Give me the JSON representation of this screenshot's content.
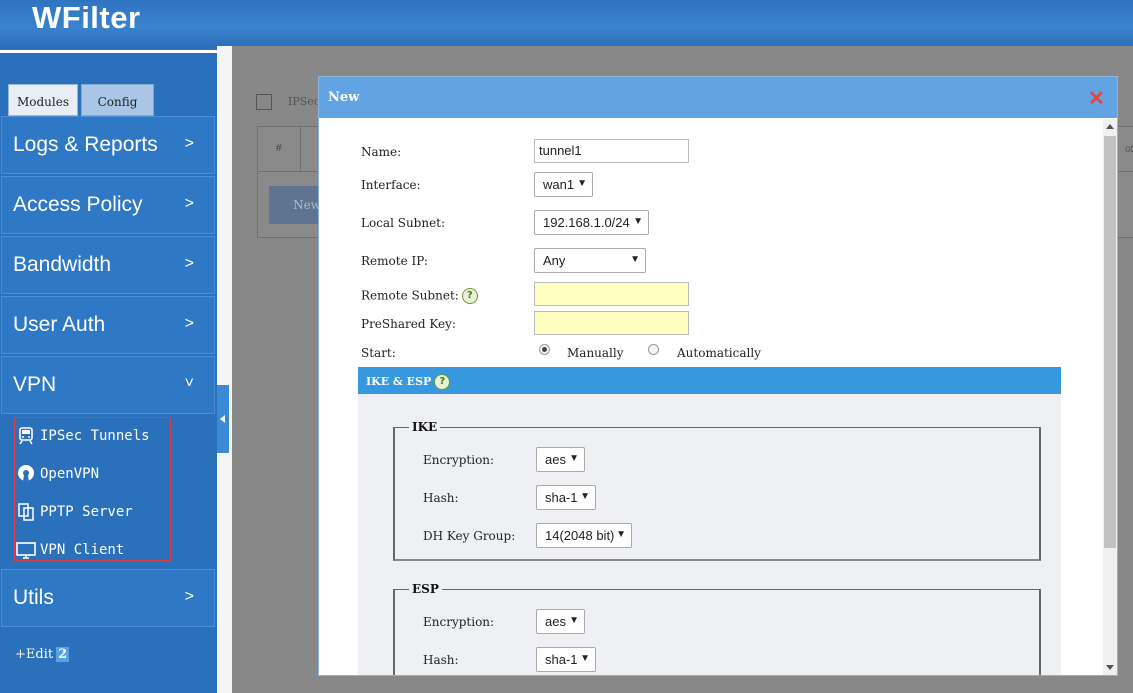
{
  "app": {
    "logo": "WFilter"
  },
  "sidebar": {
    "tabs": [
      {
        "label": "Modules"
      },
      {
        "label": "Config"
      }
    ],
    "menu": [
      {
        "label": "Logs & Reports",
        "arrow": ">"
      },
      {
        "label": "Access Policy",
        "arrow": ">"
      },
      {
        "label": "Bandwidth",
        "arrow": ">"
      },
      {
        "label": "User Auth",
        "arrow": ">"
      },
      {
        "label": "VPN",
        "arrow": "˅"
      },
      {
        "label": "Utils",
        "arrow": ">"
      }
    ],
    "vpn_items": [
      {
        "label": "IPSec Tunnels",
        "icon": "train-icon"
      },
      {
        "label": "OpenVPN",
        "icon": "openvpn-icon"
      },
      {
        "label": "PPTP Server",
        "icon": "pptp-icon"
      },
      {
        "label": "VPN Client",
        "icon": "monitor-icon"
      }
    ],
    "edit": {
      "label": "+Edit",
      "count": "2"
    }
  },
  "background_page": {
    "title": "IPSec V",
    "hash": "#",
    "new_button": "New",
    "right_fragment": "ot"
  },
  "dialog": {
    "title": "New",
    "close": "✕",
    "fields": {
      "name": {
        "label": "Name:",
        "value": "tunnel1"
      },
      "interface": {
        "label": "Interface:",
        "value": "wan1"
      },
      "local_subnet": {
        "label": "Local Subnet:",
        "value": "192.168.1.0/24"
      },
      "remote_ip": {
        "label": "Remote IP:",
        "value": "Any"
      },
      "remote_subnet": {
        "label": "Remote Subnet:",
        "value": ""
      },
      "preshared_key": {
        "label": "PreShared Key:",
        "value": ""
      },
      "start": {
        "label": "Start:",
        "options": [
          "Manually",
          "Automatically"
        ],
        "selected": "Manually"
      }
    },
    "section": {
      "title": "IKE & ESP"
    },
    "ike": {
      "legend": "IKE",
      "encryption": {
        "label": "Encryption:",
        "value": "aes"
      },
      "hash": {
        "label": "Hash:",
        "value": "sha-1"
      },
      "dh_group": {
        "label": "DH Key Group:",
        "value": "14(2048 bit)"
      }
    },
    "esp": {
      "legend": "ESP",
      "encryption": {
        "label": "Encryption:",
        "value": "aes"
      },
      "hash": {
        "label": "Hash:",
        "value": "sha-1"
      }
    }
  },
  "colors": {
    "sidebar": "#2a70bb",
    "dialog_header": "#62a3e4",
    "section_bar": "#3699e0",
    "close": "#e8453c"
  }
}
